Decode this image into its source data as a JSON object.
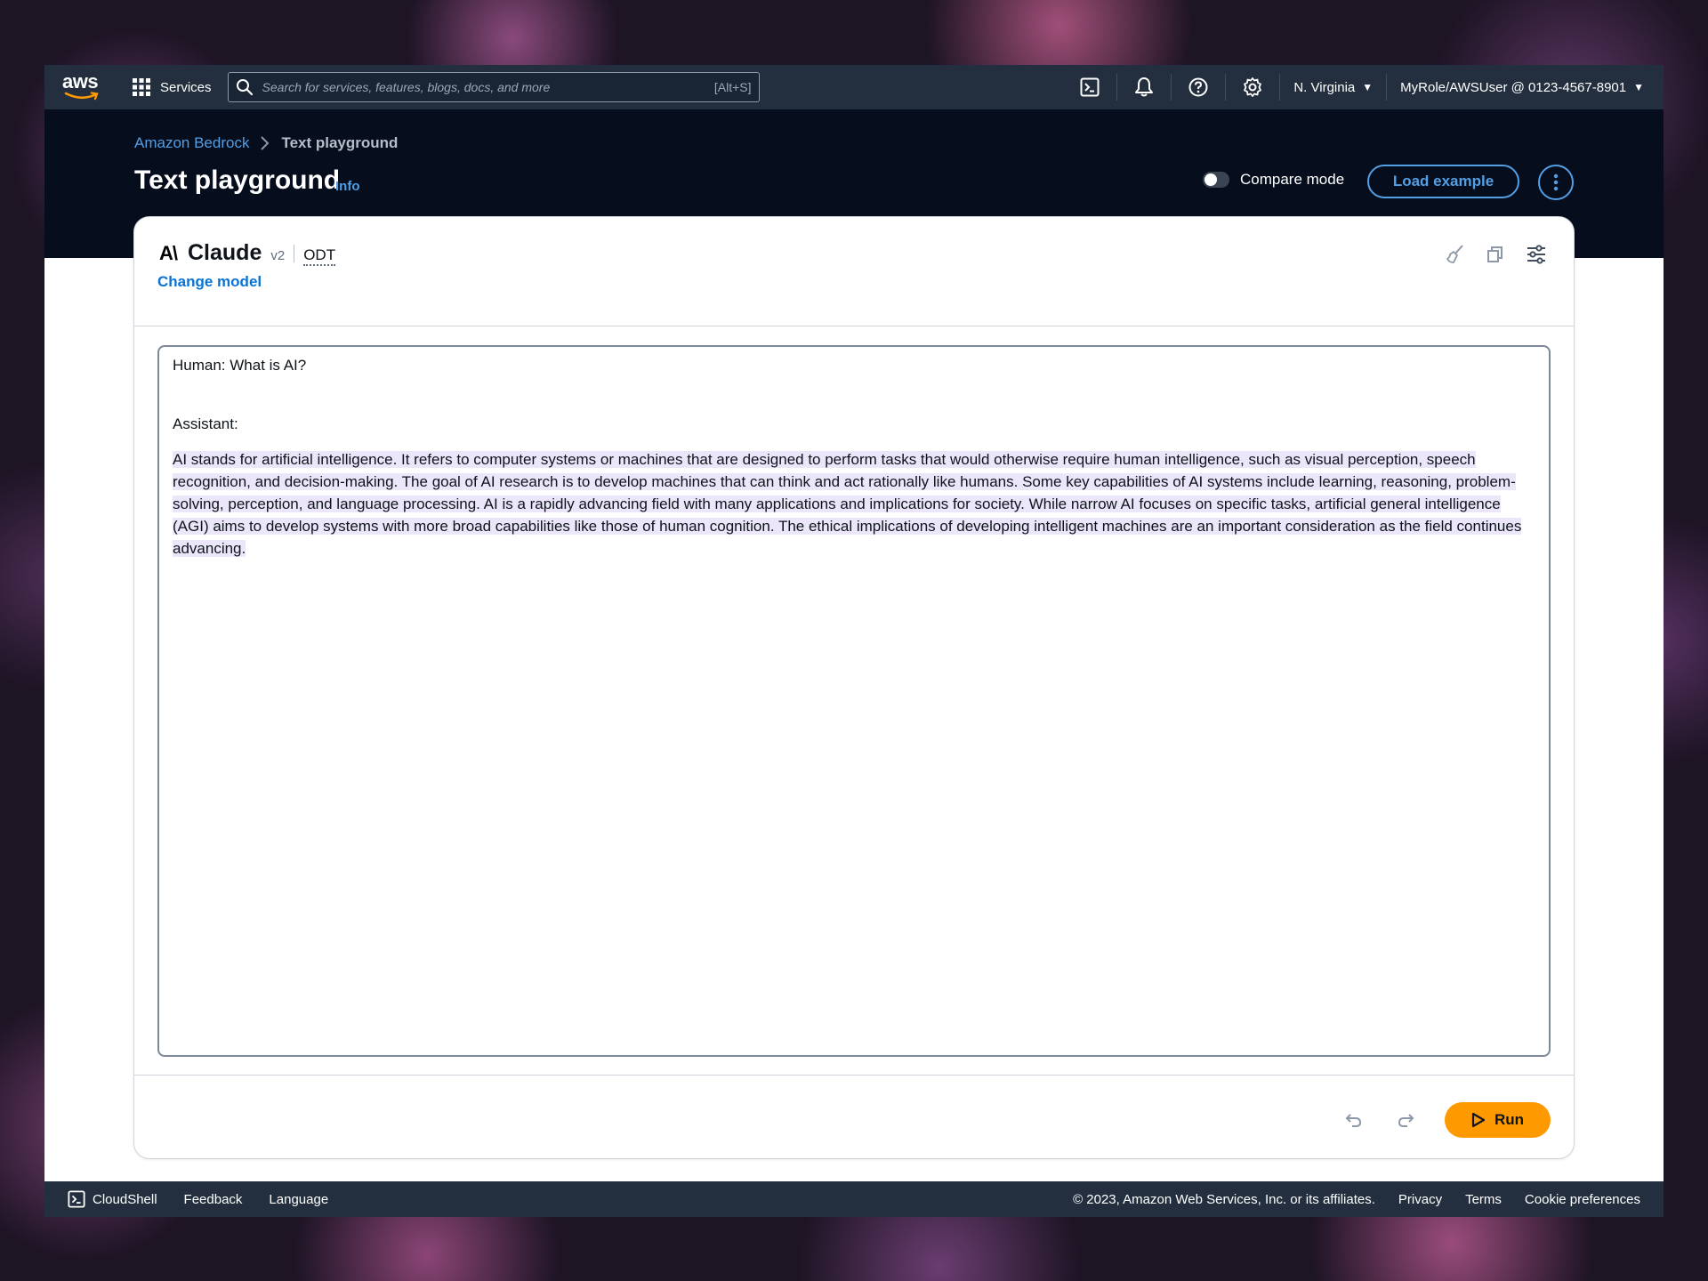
{
  "nav": {
    "logo_text": "aws",
    "services_label": "Services",
    "search_placeholder": "Search for services, features, blogs, docs, and more",
    "search_shortcut": "[Alt+S]",
    "region": "N. Virginia",
    "account": "MyRole/AWSUser @ 0123-4567-8901"
  },
  "header": {
    "breadcrumb": [
      "Amazon Bedrock",
      "Text playground"
    ],
    "title": "Text playground",
    "info_label": "Info",
    "compare_mode_label": "Compare mode",
    "compare_mode_on": false,
    "load_example_label": "Load example"
  },
  "card": {
    "model_name": "Claude",
    "model_version": "v2",
    "model_tag": "ODT",
    "change_model_label": "Change model",
    "prompt_human": "Human: What is AI?",
    "prompt_assistant": "Assistant:",
    "response_text": "AI stands for artificial intelligence. It refers to computer systems or machines that are designed to perform tasks that would otherwise require human intelligence, such as visual perception, speech recognition, and decision-making. The goal of AI research is to develop machines that can think and act rationally like humans. Some key capabilities of AI systems include learning, reasoning, problem-solving, perception, and language processing. AI is a rapidly advancing field with many applications and implications for society. While narrow AI focuses on specific tasks, artificial general intelligence (AGI) aims to develop systems with more broad capabilities like those of human cognition. The ethical implications of developing intelligent machines are an important consideration as the field continues advancing.",
    "run_label": "Run"
  },
  "footer": {
    "cloudshell_label": "CloudShell",
    "feedback_label": "Feedback",
    "language_label": "Language",
    "copyright": "© 2023, Amazon Web Services, Inc. or its affiliates.",
    "privacy_label": "Privacy",
    "terms_label": "Terms",
    "cookie_label": "Cookie preferences"
  },
  "colors": {
    "nav_bg": "#232f3e",
    "header_bg": "#060d1c",
    "link_blue": "#539fe5",
    "run_orange": "#ff9900",
    "highlight": "#ece6fb"
  }
}
